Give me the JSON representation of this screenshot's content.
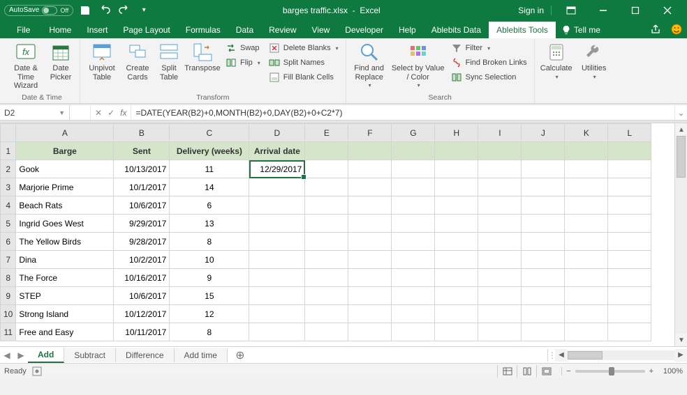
{
  "titlebar": {
    "autosave_label": "AutoSave",
    "autosave_state": "Off",
    "filename": "barges traffic.xlsx",
    "app": "Excel",
    "sign_in": "Sign in"
  },
  "tabs": {
    "file": "File",
    "home": "Home",
    "insert": "Insert",
    "page_layout": "Page Layout",
    "formulas": "Formulas",
    "data": "Data",
    "review": "Review",
    "view": "View",
    "developer": "Developer",
    "help": "Help",
    "ablebits_data": "Ablebits Data",
    "ablebits_tools": "Ablebits Tools",
    "tell_me": "Tell me"
  },
  "ribbon": {
    "date_time_wizard": "Date & Time Wizard",
    "date_picker": "Date Picker",
    "group_date_time": "Date & Time",
    "unpivot_table": "Unpivot Table",
    "create_cards": "Create Cards",
    "split_table": "Split Table",
    "transpose": "Transpose",
    "swap": "Swap",
    "flip": "Flip",
    "delete_blanks": "Delete Blanks",
    "split_names": "Split Names",
    "fill_blank_cells": "Fill Blank Cells",
    "group_transform": "Transform",
    "find_and_replace": "Find and Replace",
    "select_by_value_color": "Select by Value / Color",
    "filter": "Filter",
    "find_broken_links": "Find Broken Links",
    "sync_selection": "Sync Selection",
    "group_search": "Search",
    "calculate": "Calculate",
    "utilities": "Utilities"
  },
  "formula_bar": {
    "name_box": "D2",
    "formula": "=DATE(YEAR(B2)+0,MONTH(B2)+0,DAY(B2)+0+C2*7)"
  },
  "columns": [
    "A",
    "B",
    "C",
    "D",
    "E",
    "F",
    "G",
    "H",
    "I",
    "J",
    "K",
    "L"
  ],
  "headers": {
    "barge": "Barge",
    "sent": "Sent",
    "delivery": "Delivery  (weeks)",
    "arrival": "Arrival date"
  },
  "rows": [
    {
      "n": 2,
      "barge": "Gook",
      "sent": "10/13/2017",
      "delivery": "11",
      "arrival": "12/29/2017"
    },
    {
      "n": 3,
      "barge": "Marjorie Prime",
      "sent": "10/1/2017",
      "delivery": "14",
      "arrival": ""
    },
    {
      "n": 4,
      "barge": "Beach Rats",
      "sent": "10/6/2017",
      "delivery": "6",
      "arrival": ""
    },
    {
      "n": 5,
      "barge": "Ingrid Goes West",
      "sent": "9/29/2017",
      "delivery": "13",
      "arrival": ""
    },
    {
      "n": 6,
      "barge": "The Yellow Birds",
      "sent": "9/28/2017",
      "delivery": "8",
      "arrival": ""
    },
    {
      "n": 7,
      "barge": "Dina",
      "sent": "10/2/2017",
      "delivery": "10",
      "arrival": ""
    },
    {
      "n": 8,
      "barge": "The Force",
      "sent": "10/16/2017",
      "delivery": "9",
      "arrival": ""
    },
    {
      "n": 9,
      "barge": "STEP",
      "sent": "10/6/2017",
      "delivery": "15",
      "arrival": ""
    },
    {
      "n": 10,
      "barge": "Strong Island",
      "sent": "10/12/2017",
      "delivery": "12",
      "arrival": ""
    },
    {
      "n": 11,
      "barge": "Free and Easy",
      "sent": "10/11/2017",
      "delivery": "8",
      "arrival": ""
    }
  ],
  "sheets": {
    "add": "Add",
    "subtract": "Subtract",
    "difference": "Difference",
    "add_time": "Add time"
  },
  "status": {
    "ready": "Ready",
    "zoom": "100%"
  }
}
